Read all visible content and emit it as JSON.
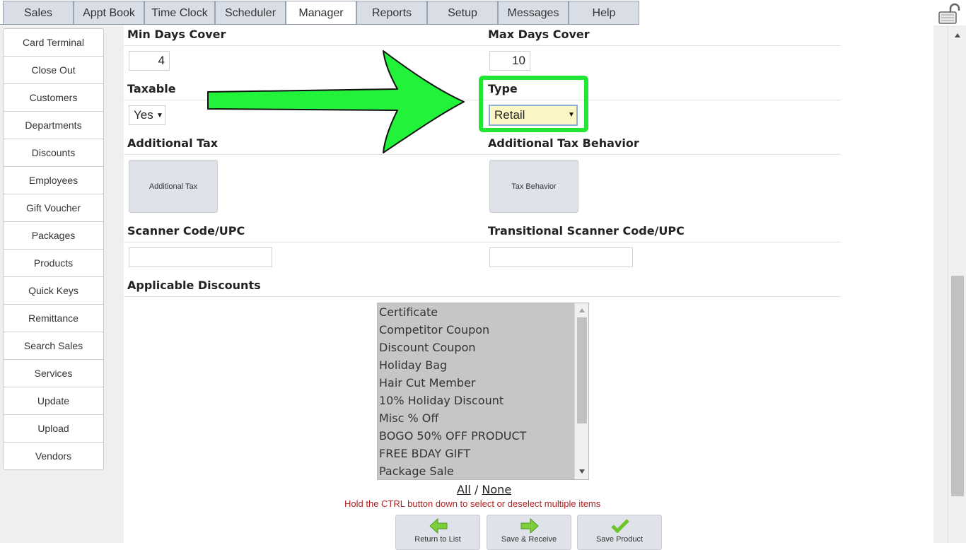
{
  "nav": {
    "tabs": [
      "Sales",
      "Appt Book",
      "Time Clock",
      "Scheduler",
      "Manager",
      "Reports",
      "Setup",
      "Messages",
      "Help"
    ],
    "active": "Manager"
  },
  "sidebar": {
    "items": [
      "Card Terminal",
      "Close Out",
      "Customers",
      "Departments",
      "Discounts",
      "Employees",
      "Gift Voucher",
      "Packages",
      "Products",
      "Quick Keys",
      "Remittance",
      "Search Sales",
      "Services",
      "Update",
      "Upload",
      "Vendors"
    ]
  },
  "form": {
    "min_days_cover": {
      "label": "Min Days Cover",
      "value": "4"
    },
    "max_days_cover": {
      "label": "Max Days Cover",
      "value": "10"
    },
    "taxable": {
      "label": "Taxable",
      "value": "Yes"
    },
    "type": {
      "label": "Type",
      "value": "Retail"
    },
    "additional_tax": {
      "label": "Additional Tax",
      "button": "Additional Tax"
    },
    "additional_tax_behavior": {
      "label": "Additional Tax Behavior",
      "button": "Tax Behavior"
    },
    "scanner_code": {
      "label": "Scanner Code/UPC",
      "value": ""
    },
    "transitional_scanner_code": {
      "label": "Transitional Scanner Code/UPC",
      "value": ""
    },
    "applicable_discounts": {
      "label": "Applicable Discounts",
      "options": [
        "Certificate",
        "Competitor Coupon",
        "Discount Coupon",
        "Holiday Bag",
        "Hair Cut Member",
        "10% Holiday Discount",
        "Misc % Off",
        "BOGO 50% OFF PRODUCT",
        "FREE BDAY GIFT",
        "Package Sale"
      ],
      "select_all": "All",
      "separator": "/",
      "select_none": "None",
      "hint": "Hold the CTRL button down to select or deselect multiple items"
    }
  },
  "actions": {
    "return": "Return to List",
    "save_receive": "Save & Receive",
    "save_product": "Save Product"
  },
  "colors": {
    "highlight": "#22e633",
    "arrow": "#22f23a",
    "type_select_bg": "#fbf6c4"
  }
}
